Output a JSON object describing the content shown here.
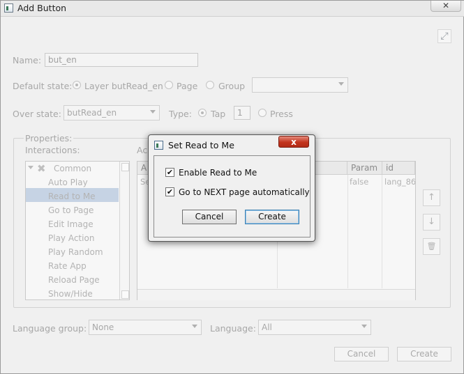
{
  "window": {
    "title": "Add Button",
    "close": "✕"
  },
  "form": {
    "name_label": "Name:",
    "name_value": "but_en",
    "default_state_label": "Default state:",
    "default_opts": [
      "Layer butRead_en",
      "Page",
      "Group"
    ],
    "default_selected": 0,
    "group_combo_value": "",
    "over_state_label": "Over state:",
    "over_state_value": "butRead_en",
    "type_label": "Type:",
    "type_opts": [
      "Tap",
      "Press"
    ],
    "type_selected": 0,
    "tap_count": "1",
    "properties_label": "Properties:",
    "interactions_label": "Interactions:",
    "actions_label_fragment": "Ac"
  },
  "tree": {
    "category": "Common",
    "items": [
      "Auto Play",
      "Read to Me",
      "Go to Page",
      "Edit Image",
      "Play Action",
      "Play Random",
      "Rate App",
      "Reload Page",
      "Show/Hide"
    ],
    "selected_index": 1
  },
  "actions_table": {
    "columns": [
      "A",
      "Param",
      "id"
    ],
    "row": {
      "first": "Se",
      "param": "false",
      "id": "lang_86"
    }
  },
  "side_buttons": {
    "up": "↑",
    "down": "↓",
    "delete": "🗑"
  },
  "footer": {
    "language_group_label": "Language group:",
    "language_group_value": "None",
    "language_label": "Language:",
    "language_value": "All",
    "cancel": "Cancel",
    "create": "Create"
  },
  "dialog": {
    "title": "Set Read to Me",
    "close": "x",
    "checkbox1": {
      "label": "Enable Read to Me",
      "checked": true
    },
    "checkbox2": {
      "label": "Go to NEXT page automatically",
      "checked": true
    },
    "cancel": "Cancel",
    "create": "Create"
  }
}
